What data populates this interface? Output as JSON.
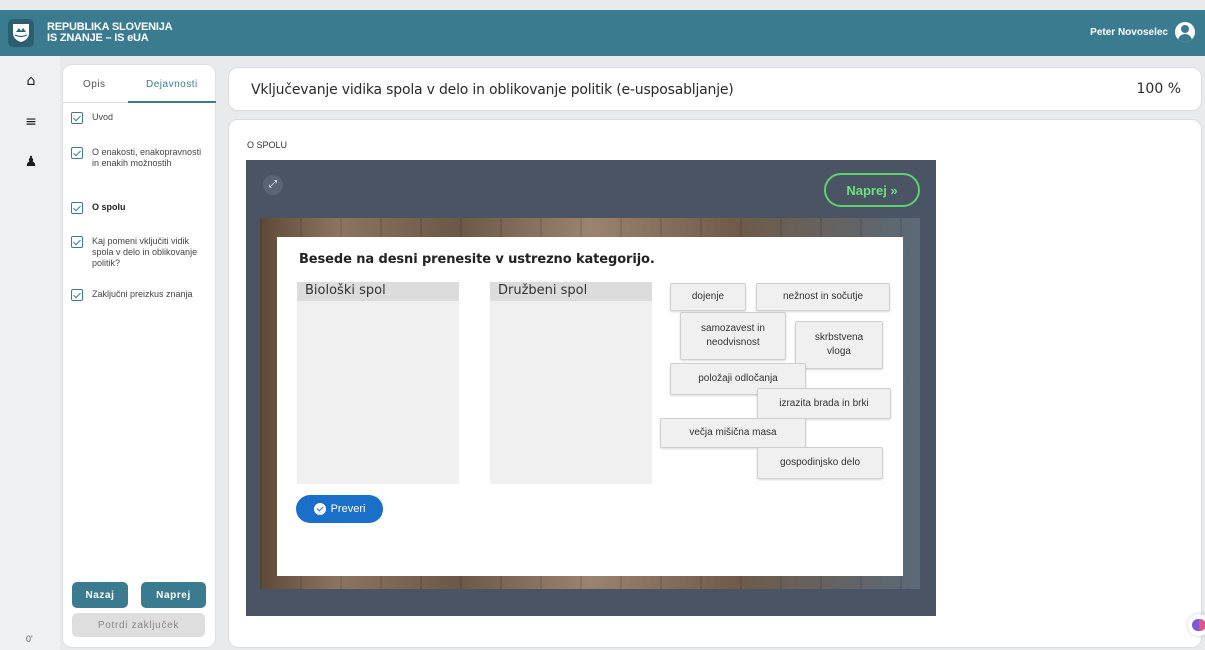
{
  "header": {
    "brand_line1": "REPUBLIKA SLOVENIJA",
    "brand_line2": "IS ZNANJE – IS eUA",
    "user_name": "Peter Novoselec"
  },
  "rail": {
    "items": [
      {
        "name": "home-icon",
        "glyph": "⌂"
      },
      {
        "name": "list-icon",
        "glyph": "≡"
      },
      {
        "name": "learner-icon",
        "glyph": "♟"
      }
    ],
    "bottom_text": "0'"
  },
  "sidebar": {
    "tabs": [
      "Opis",
      "Dejavnosti"
    ],
    "activities": [
      {
        "label": "Uvod",
        "checked": true,
        "current": false
      },
      {
        "label": "O enakosti, enakopravnosti in enakih možnostih",
        "checked": true,
        "current": false
      },
      {
        "label": "O spolu",
        "checked": true,
        "current": true
      },
      {
        "label": "Kaj pomeni vključiti vidik spola v delo in oblikovanje politik?",
        "checked": true,
        "current": false
      },
      {
        "label": "Zaključni preizkus znanja",
        "checked": true,
        "current": false
      }
    ],
    "back_label": "Nazaj",
    "next_label": "Naprej",
    "confirm_label": "Potrdi zaključek"
  },
  "course": {
    "title": "Vključevanje vidika spola v delo in oblikovanje politik (e-usposabljanje)",
    "progress": "100 %"
  },
  "section": {
    "title": "O SPOLU"
  },
  "player": {
    "next_label": "Naprej »",
    "fullscreen_icon": "expand-icon",
    "exercise": {
      "instruction": "Besede na desni prenesite v ustrezno kategorijo.",
      "categories": [
        "Biološki spol",
        "Družbeni spol"
      ],
      "words": [
        "dojenje",
        "nežnost in sočutje",
        "samozavest in neodvisnost",
        "skrbstvena vloga",
        "položaji odločanja",
        "izrazita brada in brki",
        "večja mišična masa",
        "gospodinjsko delo"
      ],
      "check_label": "Preveri"
    }
  },
  "colors": {
    "topbar": "#3b7b90",
    "accent": "#3b7b90",
    "player_bg": "#4b5465",
    "next_green": "#5ad36a",
    "check_blue": "#1a6fc9"
  }
}
